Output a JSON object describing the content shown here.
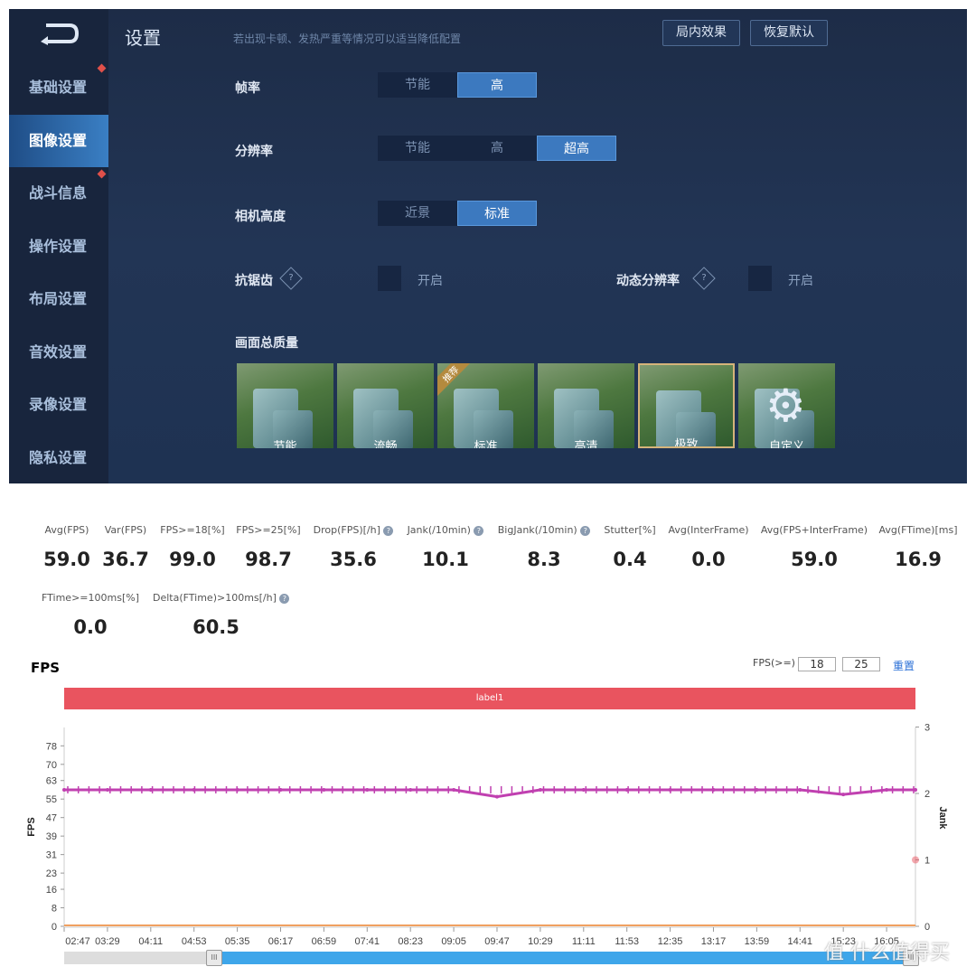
{
  "game": {
    "title": "设置",
    "hint": "若出现卡顿、发热严重等情况可以适当降低配置",
    "buttons": {
      "in_game_effect": "局内效果",
      "restore_default": "恢复默认"
    },
    "sidebar": [
      {
        "label": "基础设置",
        "dot": true
      },
      {
        "label": "图像设置",
        "active": true
      },
      {
        "label": "战斗信息",
        "dot": true
      },
      {
        "label": "操作设置"
      },
      {
        "label": "布局设置"
      },
      {
        "label": "音效设置"
      },
      {
        "label": "录像设置"
      },
      {
        "label": "隐私设置"
      }
    ],
    "frame_rate": {
      "label": "帧率",
      "options": [
        "节能",
        "高"
      ],
      "selected": "高"
    },
    "resolution": {
      "label": "分辨率",
      "options": [
        "节能",
        "高",
        "超高"
      ],
      "selected": "超高"
    },
    "camera_height": {
      "label": "相机高度",
      "options": [
        "近景",
        "标准"
      ],
      "selected": "标准"
    },
    "anti_aliasing": {
      "label": "抗锯齿",
      "option": "开启",
      "checked": false
    },
    "dynamic_resolution": {
      "label": "动态分辨率",
      "option": "开启",
      "checked": false
    },
    "quality": {
      "label": "画面总质量",
      "recommended_badge": "推荐",
      "options": [
        "节能",
        "流畅",
        "标准",
        "高清",
        "极致",
        "自定义"
      ],
      "selected": "极致"
    },
    "accent": "#3c79bf"
  },
  "stats": [
    {
      "label": "Avg(FPS)",
      "value": "59.0"
    },
    {
      "label": "Var(FPS)",
      "value": "36.7"
    },
    {
      "label": "FPS>=18[%]",
      "value": "99.0"
    },
    {
      "label": "FPS>=25[%]",
      "value": "98.7"
    },
    {
      "label": "Drop(FPS)[/h]",
      "value": "35.6",
      "help": true
    },
    {
      "label": "Jank(/10min)",
      "value": "10.1",
      "help": true
    },
    {
      "label": "BigJank(/10min)",
      "value": "8.3",
      "help": true
    },
    {
      "label": "Stutter[%]",
      "value": "0.4"
    },
    {
      "label": "Avg(InterFrame)",
      "value": "0.0"
    },
    {
      "label": "Avg(FPS+InterFrame)",
      "value": "59.0"
    },
    {
      "label": "Avg(FTime)[ms]",
      "value": "16.9"
    },
    {
      "label": "FTime>=100ms[%]",
      "value": "0.0"
    },
    {
      "label": "Delta(FTime)>100ms[/h]",
      "value": "60.5",
      "help": true
    }
  ],
  "fps_panel": {
    "title": "FPS",
    "threshold_label": "FPS(>=)",
    "threshold1": "18",
    "threshold2": "25",
    "reset": "重置",
    "band_label": "label1",
    "help_glyph": "?"
  },
  "chart_data": {
    "type": "line",
    "ylabel": "FPS",
    "y2label": "Jank",
    "y_ticks": [
      "0",
      "8",
      "16",
      "23",
      "31",
      "39",
      "47",
      "55",
      "63",
      "70",
      "78"
    ],
    "y2_ticks": [
      "0",
      "1",
      "2",
      "3"
    ],
    "y2lim": [
      0,
      3
    ],
    "x_ticks": [
      "02:47",
      "03:29",
      "04:11",
      "04:53",
      "05:35",
      "06:17",
      "06:59",
      "07:41",
      "08:23",
      "09:05",
      "09:47",
      "10:29",
      "11:11",
      "11:53",
      "12:35",
      "13:17",
      "13:59",
      "14:41",
      "15:23",
      "16:05"
    ],
    "series": [
      {
        "name": "FPS",
        "color": "#c040b0",
        "x": [
          "02:47",
          "03:29",
          "04:11",
          "04:53",
          "05:35",
          "06:17",
          "06:59",
          "07:41",
          "08:23",
          "09:05",
          "09:47",
          "10:29",
          "11:11",
          "11:53",
          "12:35",
          "13:17",
          "13:59",
          "14:41",
          "15:23",
          "16:05",
          "16:33"
        ],
        "values": [
          60,
          60,
          60,
          60,
          60,
          60,
          60,
          60,
          60,
          60,
          56,
          60,
          60,
          60,
          60,
          60,
          60,
          60,
          57,
          60,
          60
        ]
      },
      {
        "name": "Jank",
        "color": "#f0a060",
        "x": [
          "02:47",
          "16:33"
        ],
        "values": [
          0,
          0
        ]
      }
    ],
    "jank_marker": {
      "x": "16:33",
      "value": 1,
      "color": "#e9545f"
    },
    "grid": false
  },
  "scrollbar": {
    "start_fraction": 0.18,
    "end_fraction": 1.0,
    "handle_glyph": "III"
  },
  "watermark": "值 什么值得买"
}
